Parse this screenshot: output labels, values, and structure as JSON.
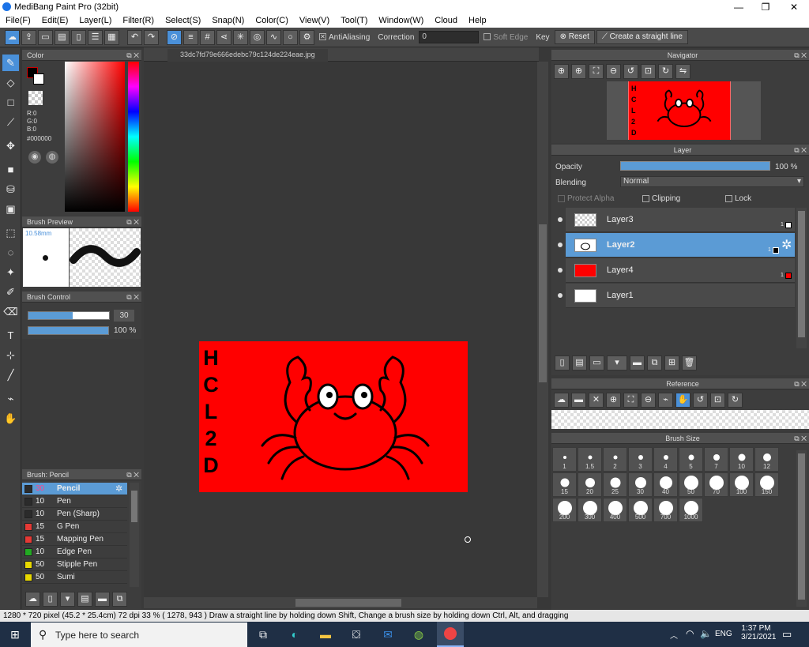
{
  "window": {
    "title": "MediBang Paint Pro (32bit)",
    "min": "—",
    "max": "❐",
    "close": "✕"
  },
  "menu": [
    "File(F)",
    "Edit(E)",
    "Layer(L)",
    "Filter(R)",
    "Select(S)",
    "Snap(N)",
    "Color(C)",
    "View(V)",
    "Tool(T)",
    "Window(W)",
    "Cloud",
    "Help"
  ],
  "toolbar": {
    "antialiasing": "AntiAliasing",
    "correction_label": "Correction",
    "correction_value": "0",
    "soft_edge": "Soft Edge",
    "key_label": "Key",
    "reset": "Reset",
    "straight_line": "Create a straight line"
  },
  "color_panel": {
    "title": "Color",
    "r": "R:0",
    "g": "G:0",
    "b": "B:0",
    "hex": "#000000"
  },
  "brush_preview": {
    "title": "Brush Preview",
    "size": "10.58mm"
  },
  "brush_control": {
    "title": "Brush Control",
    "size": "30",
    "opacity": "100 %"
  },
  "brush_list": {
    "title": "Brush: Pencil",
    "items": [
      {
        "size": "30",
        "name": "Pencil",
        "color": "#2b2b2b"
      },
      {
        "size": "10",
        "name": "Pen",
        "color": "#2b2b2b"
      },
      {
        "size": "10",
        "name": "Pen (Sharp)",
        "color": "#2b2b2b"
      },
      {
        "size": "15",
        "name": "G Pen",
        "color": "#e53935"
      },
      {
        "size": "15",
        "name": "Mapping Pen",
        "color": "#e53935"
      },
      {
        "size": "10",
        "name": "Edge Pen",
        "color": "#22aa22"
      },
      {
        "size": "50",
        "name": "Stipple Pen",
        "color": "#e8d800"
      },
      {
        "size": "50",
        "name": "Sumi",
        "color": "#e8d800"
      }
    ]
  },
  "canvas": {
    "tab": "33dc7fd79e666edebc79c124de224eae.jpg",
    "art_text": "HCL2D"
  },
  "navigator": {
    "title": "Navigator"
  },
  "layer_panel": {
    "title": "Layer",
    "opacity_label": "Opacity",
    "opacity_value": "100 %",
    "blending_label": "Blending",
    "blending_value": "Normal",
    "protect_alpha": "Protect Alpha",
    "clipping": "Clipping",
    "lock": "Lock",
    "layers": [
      {
        "name": "Layer3",
        "num": "1"
      },
      {
        "name": "Layer2",
        "num": "1"
      },
      {
        "name": "Layer4",
        "num": "1"
      },
      {
        "name": "Layer1",
        "num": ""
      }
    ]
  },
  "reference": {
    "title": "Reference"
  },
  "brush_size": {
    "title": "Brush Size",
    "sizes": [
      "1",
      "1.5",
      "2",
      "3",
      "4",
      "5",
      "7",
      "10",
      "12",
      "15",
      "20",
      "25",
      "30",
      "40",
      "50",
      "70",
      "100",
      "150",
      "200",
      "300",
      "400",
      "500",
      "700",
      "1000"
    ]
  },
  "status": "1280 * 720 pixel   (45.2 * 25.4cm)   72 dpi   33 %   ( 1278, 943 )   Draw a straight line by holding down Shift, Change a brush size by holding down Ctrl, Alt, and dragging",
  "taskbar": {
    "search": "Type here to search",
    "lang": "ENG",
    "time": "1:37 PM",
    "date": "3/21/2021"
  }
}
